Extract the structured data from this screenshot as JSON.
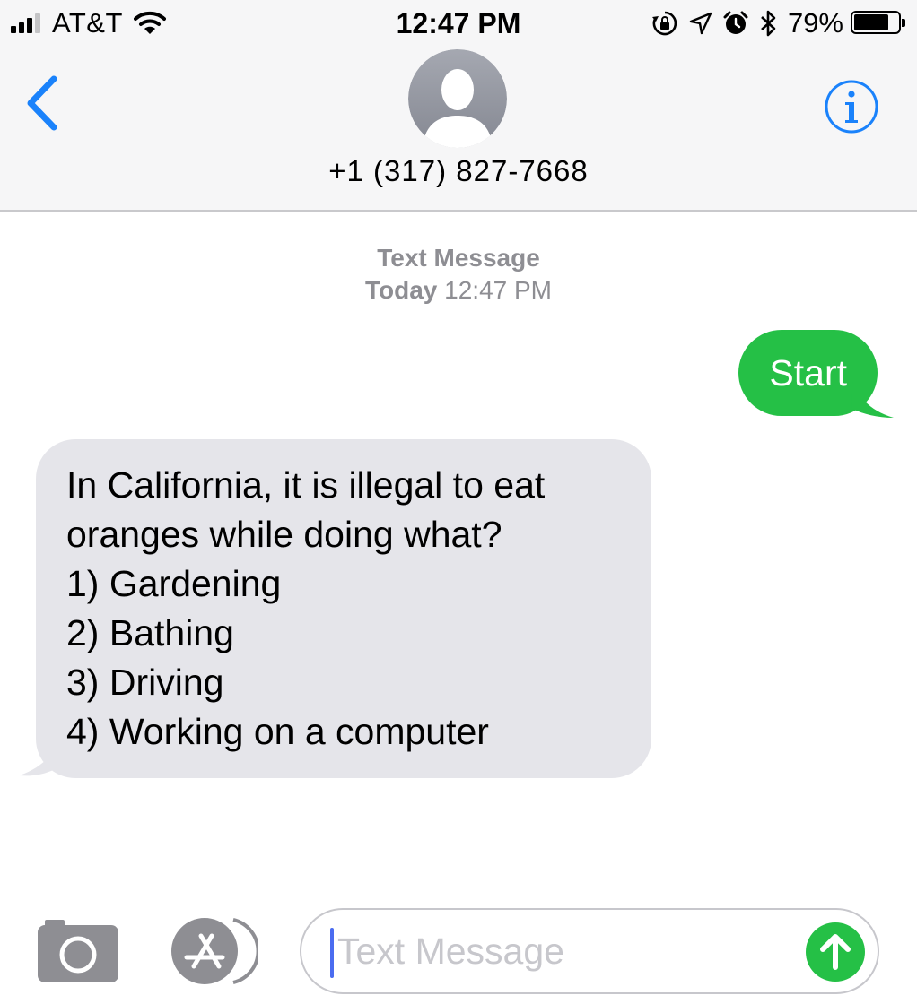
{
  "status_bar": {
    "carrier": "AT&T",
    "time": "12:47 PM",
    "battery_percent": "79%",
    "battery_level": 0.79,
    "signal_bars": 3,
    "icons": [
      "signal-icon",
      "wifi-icon",
      "orientation-lock-icon",
      "location-icon",
      "alarm-icon",
      "bluetooth-icon",
      "battery-icon"
    ]
  },
  "header": {
    "contact": "+1 (317) 827-7668",
    "icons": [
      "back-chevron-icon",
      "avatar-icon",
      "info-icon"
    ]
  },
  "thread": {
    "service_label": "Text Message",
    "date_label": "Today",
    "time_label": "12:47 PM",
    "messages": [
      {
        "direction": "outgoing",
        "lines": [
          "Start"
        ]
      },
      {
        "direction": "incoming",
        "lines": [
          "In California, it is illegal to eat",
          "oranges while doing what?",
          "1) Gardening",
          "2) Bathing",
          "3) Driving",
          "4) Working on a computer"
        ]
      }
    ]
  },
  "composer": {
    "placeholder": "Text Message",
    "icons": [
      "camera-icon",
      "app-store-icon",
      "send-arrow-icon"
    ]
  },
  "colors": {
    "accent_blue": "#1a82fb",
    "outgoing_bubble": "#25c046",
    "incoming_bubble": "#e5e5ea",
    "bar_background": "#f6f6f7",
    "secondary_text": "#8e8e93"
  }
}
